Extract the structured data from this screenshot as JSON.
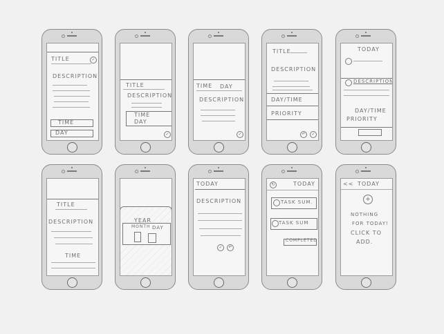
{
  "screens": [
    {
      "title": "TITLE",
      "description": "DESCRIPTION",
      "time": "TIME",
      "day": "DAY"
    },
    {
      "title": "TITLE",
      "description": "DESCRIPTION",
      "time": "TIME",
      "day": "DAY"
    },
    {
      "time": "TIME",
      "day": "DAY",
      "description": "DESCRIPTION"
    },
    {
      "title": "TITLE",
      "description": "DESCRIPTION",
      "daytime": "DAY/TIME",
      "priority": "PRIORITY"
    },
    {
      "header": "TODAY",
      "description": "DESCRIPTION",
      "daytime": "DAY/TIME",
      "priority": "PRIORITY"
    },
    {
      "title": "TITLE",
      "description": "DESCRIPTION",
      "time": "TIME"
    },
    {
      "year": "YEAR",
      "month": "MONTH",
      "day": "DAY"
    },
    {
      "header": "TODAY",
      "description": "DESCRIPTION"
    },
    {
      "header": "TODAY",
      "task1": "TASK SUM.",
      "task2": "TASK SUM",
      "completed": "COMPLETED"
    },
    {
      "back": "<<",
      "header": "TODAY",
      "msg1": "NOTHING",
      "msg2": "FOR TODAY!",
      "msg3": "CLICK TO",
      "msg4": "ADD."
    }
  ]
}
